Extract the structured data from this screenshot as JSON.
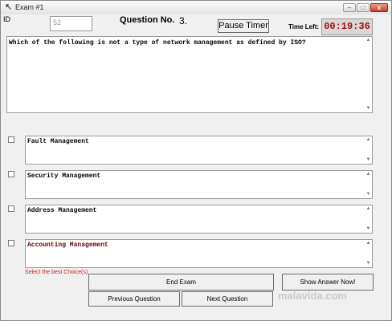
{
  "window": {
    "title": "Exam #1",
    "icon": "cursor-icon",
    "controls": {
      "minimize": "–",
      "maximize": "□",
      "close": "x"
    }
  },
  "header": {
    "id_label": "ID",
    "id_value": "52",
    "question_no_label": "Question No.",
    "question_no_value": "3.",
    "pause_button": "Pause Timer",
    "time_left_label": "Time Left:",
    "time_left_value": "00:19:36"
  },
  "question": {
    "text": "Which of the following is not a type of network management as defined by ISO?"
  },
  "choices": [
    {
      "label": "Fault Management",
      "checked": false
    },
    {
      "label": "Security Management",
      "checked": false
    },
    {
      "label": "Address Management",
      "checked": false
    },
    {
      "label": "Accounting Management",
      "checked": false
    }
  ],
  "hint": "Select the best Choice(s)",
  "buttons": {
    "end_exam": "End Exam",
    "previous_question": "Previous Question",
    "next_question": "Next Question",
    "show_answer": "Show Answer Now!"
  },
  "watermark": "malavida.com",
  "colors": {
    "timer": "#9b1010",
    "hint": "#cc1a1a"
  }
}
